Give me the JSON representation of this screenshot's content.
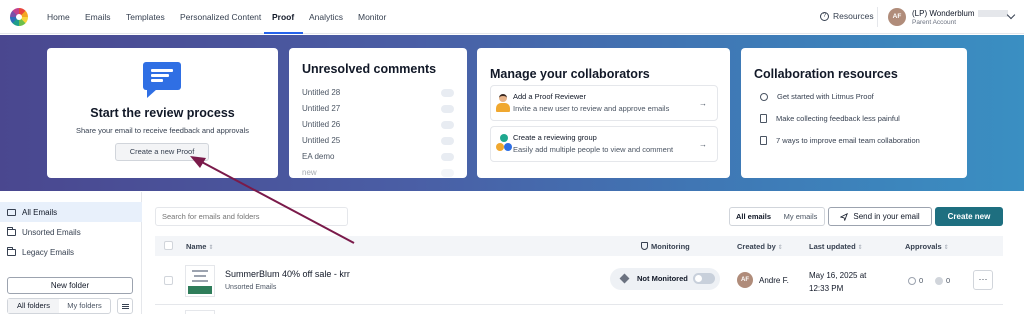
{
  "nav": {
    "items": [
      "Home",
      "Emails",
      "Templates",
      "Personalized Content",
      "Proof",
      "Analytics",
      "Monitor"
    ],
    "active": "Proof",
    "resources": "Resources",
    "user_initials": "AF",
    "user_name": "(LP) Wonderblum",
    "user_role": "Parent Account"
  },
  "review_card": {
    "title": "Start the review process",
    "subtitle": "Share your email to receive feedback and approvals",
    "button": "Create a new Proof"
  },
  "comments_card": {
    "title": "Unresolved comments",
    "items": [
      "Untitled 28",
      "Untitled 27",
      "Untitled 26",
      "Untitled 25",
      "EA demo",
      "new"
    ]
  },
  "collaborators_card": {
    "title": "Manage your collaborators",
    "options": [
      {
        "title": "Add a Proof Reviewer",
        "subtitle": "Invite a new user to review and approve emails"
      },
      {
        "title": "Create a reviewing group",
        "subtitle": "Easily add multiple people to view and comment"
      }
    ]
  },
  "resources_card": {
    "title": "Collaboration resources",
    "items": [
      "Get started with Litmus Proof",
      "Make collecting feedback less painful",
      "7 ways to improve email team collaboration"
    ]
  },
  "sidebar": {
    "items": [
      "All Emails",
      "Unsorted Emails",
      "Legacy Emails"
    ],
    "new_folder": "New folder",
    "tabs": [
      "All folders",
      "My folders"
    ]
  },
  "toolbar": {
    "search_placeholder": "Search for emails and folders",
    "filter": [
      "All emails",
      "My emails"
    ],
    "send_button": "Send in your email",
    "create_button": "Create new"
  },
  "table": {
    "columns": [
      "Name",
      "Monitoring",
      "Created by",
      "Last updated",
      "Approvals"
    ],
    "rows": [
      {
        "title": "SummerBlum 40% off sale - krr",
        "folder": "Unsorted Emails",
        "monitoring": "Not Monitored",
        "creator_initials": "AF",
        "creator": "Andre F.",
        "updated": "May 16, 2025 at 12:33 PM",
        "approvals_pending": "0",
        "approvals_done": "0",
        "more": "···"
      }
    ]
  },
  "colors": {
    "accent": "#2563eb",
    "create_button": "#1e6f80",
    "annotation_arrow": "#7a1a4a"
  }
}
